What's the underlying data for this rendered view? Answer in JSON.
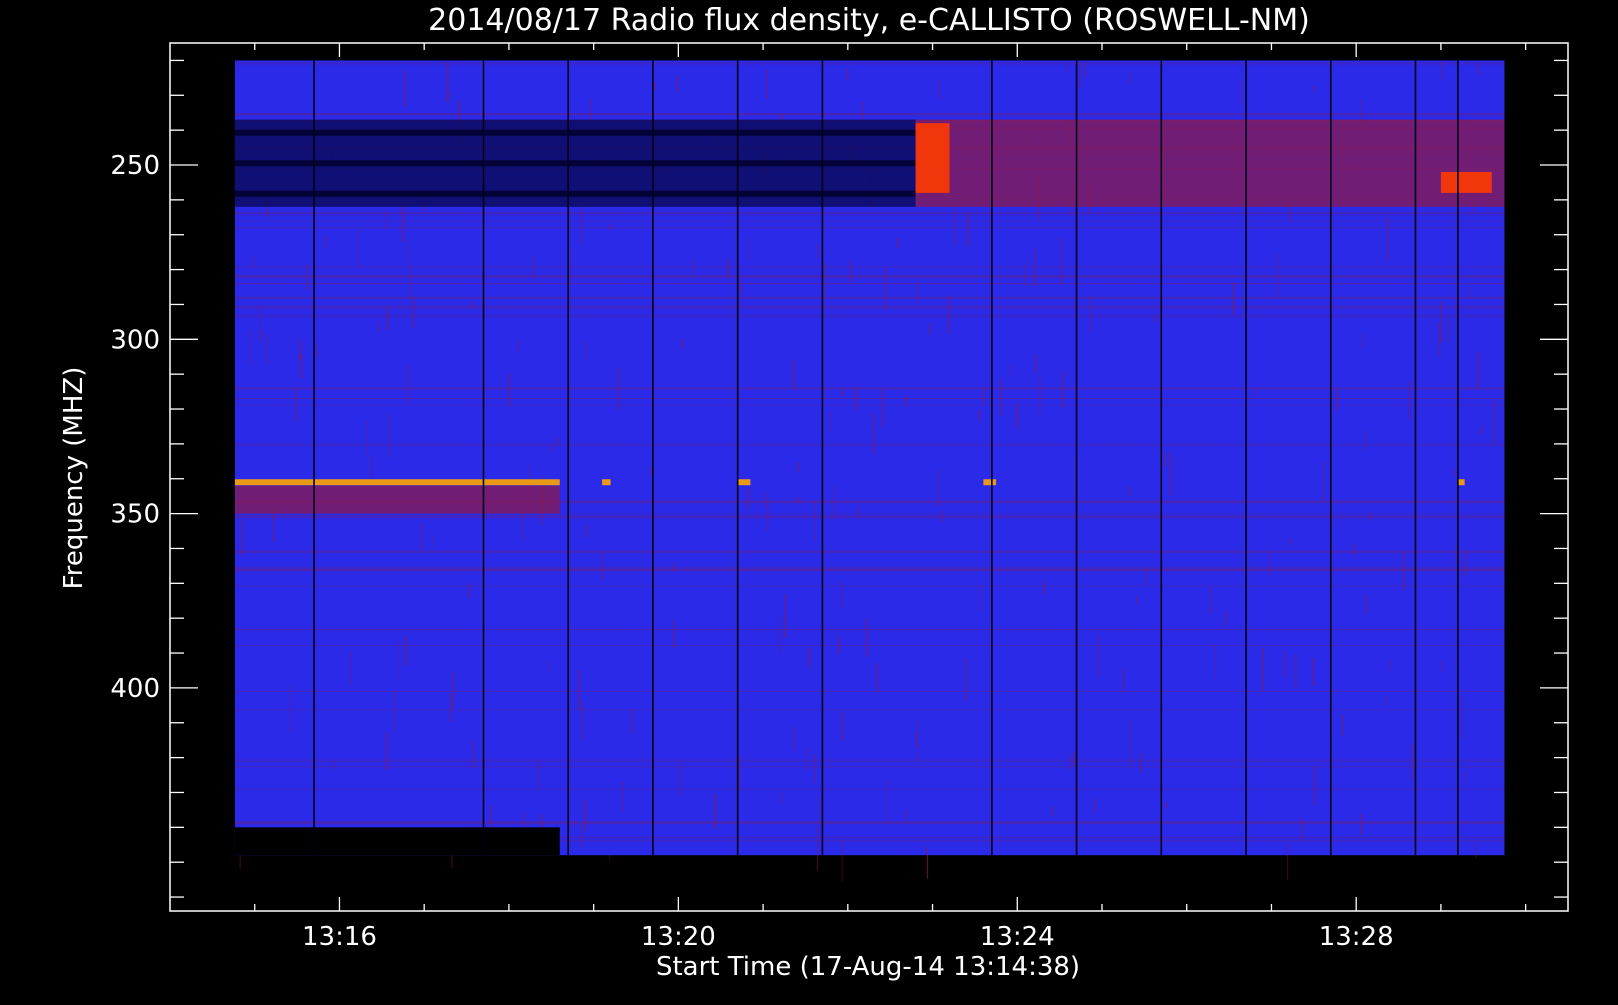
{
  "chart_data": {
    "type": "heatmap",
    "title": "2014/08/17  Radio flux density, e-CALLISTO (ROSWELL-NM)",
    "xlabel": "Start Time (17-Aug-14 13:14:38)",
    "ylabel": "Frequency (MHZ)",
    "x_ticks": [
      "13:16",
      "13:20",
      "13:24",
      "13:28"
    ],
    "y_ticks": [
      "250",
      "300",
      "350",
      "400"
    ],
    "x_tick_minutes": [
      16,
      20,
      24,
      28
    ],
    "y_tick_mhz": [
      250,
      300,
      350,
      400
    ],
    "xlim_minutes": [
      14.0,
      30.5
    ],
    "ylim_mhz": [
      464,
      215
    ],
    "data_extent": {
      "x_minutes": [
        14.766,
        29.75
      ],
      "y_mhz": [
        220,
        448
      ]
    },
    "colormap": {
      "low": "#0a0a60",
      "background": "#2a2ae8",
      "mid": "#8a1a50",
      "high": "#ff3a00",
      "max": "#ffa500"
    },
    "features": [
      {
        "kind": "band",
        "label": "dark absorption bands",
        "x_minutes": [
          14.766,
          22.8
        ],
        "y_mhz": [
          237,
          262
        ],
        "level": "low"
      },
      {
        "kind": "band",
        "label": "enhanced emission bands",
        "x_minutes": [
          22.8,
          29.75
        ],
        "y_mhz": [
          237,
          262
        ],
        "level": "mid"
      },
      {
        "kind": "burst",
        "x_minutes": [
          22.8,
          23.2
        ],
        "y_mhz": [
          238,
          258
        ],
        "level": "high"
      },
      {
        "kind": "burst",
        "x_minutes": [
          29.0,
          29.6
        ],
        "y_mhz": [
          252,
          258
        ],
        "level": "high"
      },
      {
        "kind": "line",
        "label": "narrowband carrier",
        "x_minutes": [
          14.766,
          18.6
        ],
        "y_mhz": 341,
        "level": "max"
      },
      {
        "kind": "band",
        "x_minutes": [
          14.766,
          18.6
        ],
        "y_mhz": [
          342,
          350
        ],
        "level": "mid"
      },
      {
        "kind": "spike",
        "x_minutes": [
          19.1,
          19.2
        ],
        "y_mhz": 341,
        "level": "max"
      },
      {
        "kind": "spike",
        "x_minutes": [
          20.7,
          20.85
        ],
        "y_mhz": 341,
        "level": "max"
      },
      {
        "kind": "spike",
        "x_minutes": [
          23.6,
          23.75
        ],
        "y_mhz": 341,
        "level": "max"
      },
      {
        "kind": "spike",
        "x_minutes": [
          29.2,
          29.28
        ],
        "y_mhz": 341,
        "level": "max"
      },
      {
        "kind": "gap",
        "label": "no data",
        "x_minutes": [
          14.766,
          18.6
        ],
        "y_mhz": [
          440,
          448
        ]
      }
    ],
    "vertical_lines_minutes": [
      15.7,
      17.7,
      18.7,
      19.7,
      20.7,
      21.7,
      23.7,
      24.7,
      25.7,
      26.7,
      27.7,
      28.7,
      29.2
    ],
    "grid": false,
    "legend": "none"
  }
}
